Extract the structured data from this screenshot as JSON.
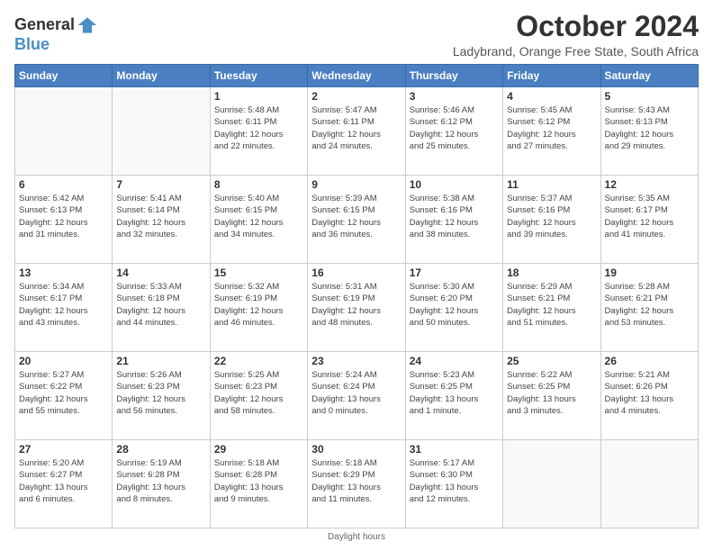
{
  "logo": {
    "line1": "General",
    "line2": "Blue"
  },
  "title": "October 2024",
  "subtitle": "Ladybrand, Orange Free State, South Africa",
  "days_of_week": [
    "Sunday",
    "Monday",
    "Tuesday",
    "Wednesday",
    "Thursday",
    "Friday",
    "Saturday"
  ],
  "footer": "Daylight hours",
  "weeks": [
    [
      {
        "day": "",
        "info": ""
      },
      {
        "day": "",
        "info": ""
      },
      {
        "day": "1",
        "info": "Sunrise: 5:48 AM\nSunset: 6:11 PM\nDaylight: 12 hours\nand 22 minutes."
      },
      {
        "day": "2",
        "info": "Sunrise: 5:47 AM\nSunset: 6:11 PM\nDaylight: 12 hours\nand 24 minutes."
      },
      {
        "day": "3",
        "info": "Sunrise: 5:46 AM\nSunset: 6:12 PM\nDaylight: 12 hours\nand 25 minutes."
      },
      {
        "day": "4",
        "info": "Sunrise: 5:45 AM\nSunset: 6:12 PM\nDaylight: 12 hours\nand 27 minutes."
      },
      {
        "day": "5",
        "info": "Sunrise: 5:43 AM\nSunset: 6:13 PM\nDaylight: 12 hours\nand 29 minutes."
      }
    ],
    [
      {
        "day": "6",
        "info": "Sunrise: 5:42 AM\nSunset: 6:13 PM\nDaylight: 12 hours\nand 31 minutes."
      },
      {
        "day": "7",
        "info": "Sunrise: 5:41 AM\nSunset: 6:14 PM\nDaylight: 12 hours\nand 32 minutes."
      },
      {
        "day": "8",
        "info": "Sunrise: 5:40 AM\nSunset: 6:15 PM\nDaylight: 12 hours\nand 34 minutes."
      },
      {
        "day": "9",
        "info": "Sunrise: 5:39 AM\nSunset: 6:15 PM\nDaylight: 12 hours\nand 36 minutes."
      },
      {
        "day": "10",
        "info": "Sunrise: 5:38 AM\nSunset: 6:16 PM\nDaylight: 12 hours\nand 38 minutes."
      },
      {
        "day": "11",
        "info": "Sunrise: 5:37 AM\nSunset: 6:16 PM\nDaylight: 12 hours\nand 39 minutes."
      },
      {
        "day": "12",
        "info": "Sunrise: 5:35 AM\nSunset: 6:17 PM\nDaylight: 12 hours\nand 41 minutes."
      }
    ],
    [
      {
        "day": "13",
        "info": "Sunrise: 5:34 AM\nSunset: 6:17 PM\nDaylight: 12 hours\nand 43 minutes."
      },
      {
        "day": "14",
        "info": "Sunrise: 5:33 AM\nSunset: 6:18 PM\nDaylight: 12 hours\nand 44 minutes."
      },
      {
        "day": "15",
        "info": "Sunrise: 5:32 AM\nSunset: 6:19 PM\nDaylight: 12 hours\nand 46 minutes."
      },
      {
        "day": "16",
        "info": "Sunrise: 5:31 AM\nSunset: 6:19 PM\nDaylight: 12 hours\nand 48 minutes."
      },
      {
        "day": "17",
        "info": "Sunrise: 5:30 AM\nSunset: 6:20 PM\nDaylight: 12 hours\nand 50 minutes."
      },
      {
        "day": "18",
        "info": "Sunrise: 5:29 AM\nSunset: 6:21 PM\nDaylight: 12 hours\nand 51 minutes."
      },
      {
        "day": "19",
        "info": "Sunrise: 5:28 AM\nSunset: 6:21 PM\nDaylight: 12 hours\nand 53 minutes."
      }
    ],
    [
      {
        "day": "20",
        "info": "Sunrise: 5:27 AM\nSunset: 6:22 PM\nDaylight: 12 hours\nand 55 minutes."
      },
      {
        "day": "21",
        "info": "Sunrise: 5:26 AM\nSunset: 6:23 PM\nDaylight: 12 hours\nand 56 minutes."
      },
      {
        "day": "22",
        "info": "Sunrise: 5:25 AM\nSunset: 6:23 PM\nDaylight: 12 hours\nand 58 minutes."
      },
      {
        "day": "23",
        "info": "Sunrise: 5:24 AM\nSunset: 6:24 PM\nDaylight: 13 hours\nand 0 minutes."
      },
      {
        "day": "24",
        "info": "Sunrise: 5:23 AM\nSunset: 6:25 PM\nDaylight: 13 hours\nand 1 minute."
      },
      {
        "day": "25",
        "info": "Sunrise: 5:22 AM\nSunset: 6:25 PM\nDaylight: 13 hours\nand 3 minutes."
      },
      {
        "day": "26",
        "info": "Sunrise: 5:21 AM\nSunset: 6:26 PM\nDaylight: 13 hours\nand 4 minutes."
      }
    ],
    [
      {
        "day": "27",
        "info": "Sunrise: 5:20 AM\nSunset: 6:27 PM\nDaylight: 13 hours\nand 6 minutes."
      },
      {
        "day": "28",
        "info": "Sunrise: 5:19 AM\nSunset: 6:28 PM\nDaylight: 13 hours\nand 8 minutes."
      },
      {
        "day": "29",
        "info": "Sunrise: 5:18 AM\nSunset: 6:28 PM\nDaylight: 13 hours\nand 9 minutes."
      },
      {
        "day": "30",
        "info": "Sunrise: 5:18 AM\nSunset: 6:29 PM\nDaylight: 13 hours\nand 11 minutes."
      },
      {
        "day": "31",
        "info": "Sunrise: 5:17 AM\nSunset: 6:30 PM\nDaylight: 13 hours\nand 12 minutes."
      },
      {
        "day": "",
        "info": ""
      },
      {
        "day": "",
        "info": ""
      }
    ]
  ]
}
